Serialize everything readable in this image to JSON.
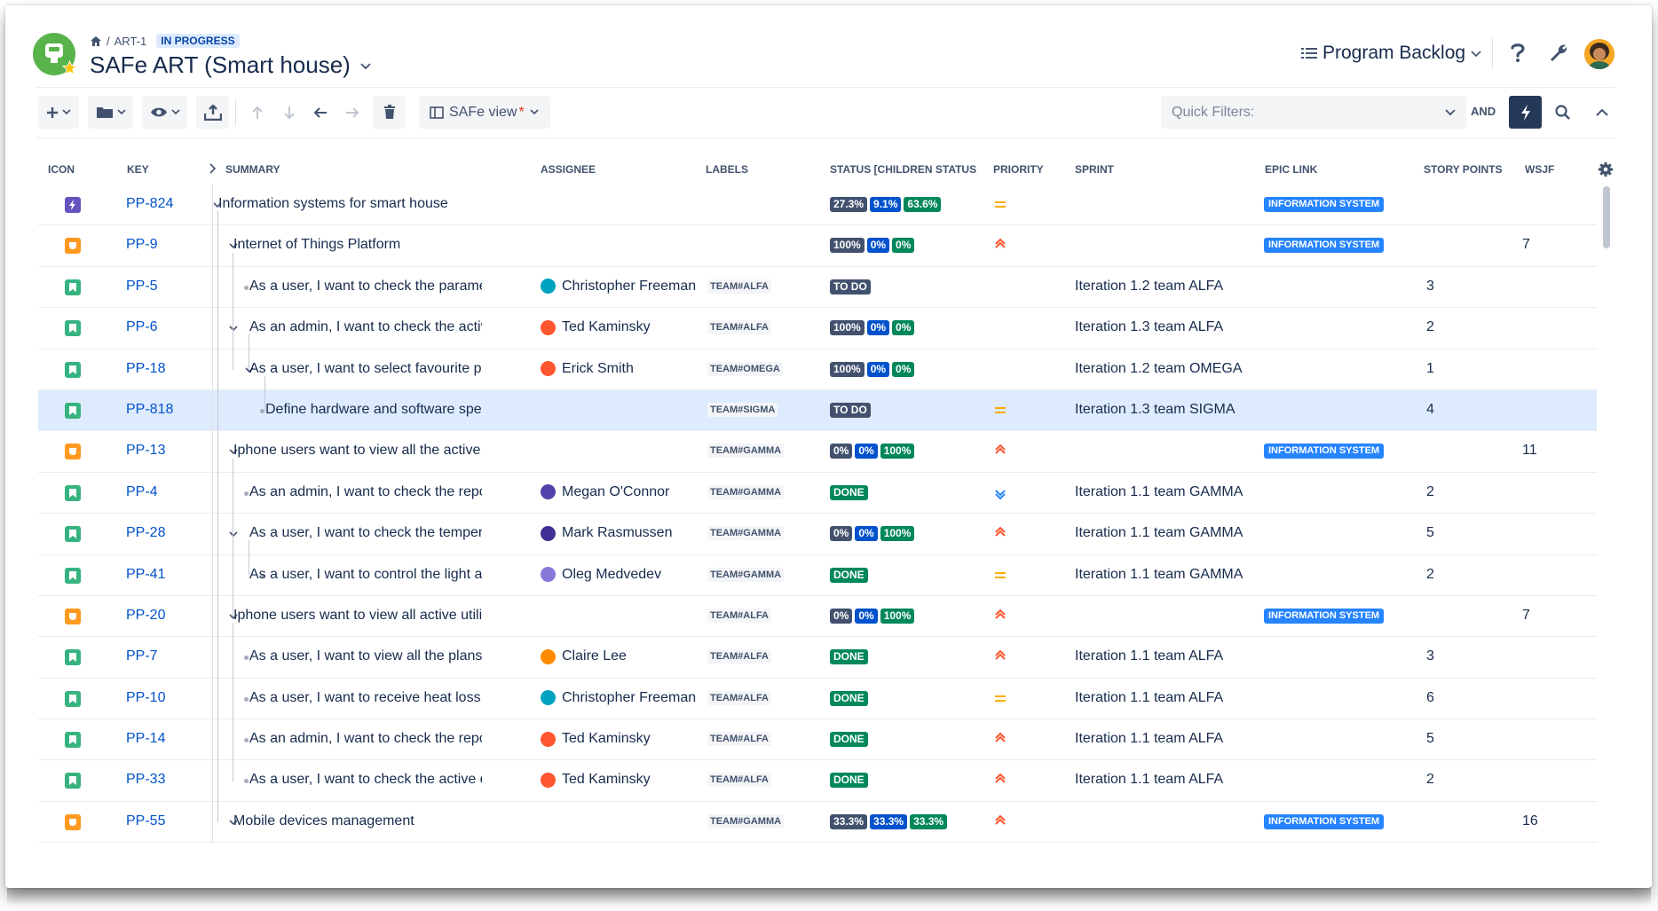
{
  "header": {
    "breadcrumb_key": "ART-1",
    "breadcrumb_status": "IN PROGRESS",
    "title": "SAFe ART (Smart house)",
    "board_switch": "Program Backlog"
  },
  "toolbar": {
    "view_label": "SAFe view",
    "view_required": "*",
    "quick_filters_placeholder": "Quick Filters:",
    "and_label": "AND"
  },
  "columns": {
    "icon": "ICON",
    "key": "KEY",
    "summary": "SUMMARY",
    "assignee": "ASSIGNEE",
    "labels": "LABELS",
    "status": "STATUS [CHILDREN STATUS",
    "priority": "PRIORITY",
    "sprint": "SPRINT",
    "epic_link": "EPIC LINK",
    "story_points": "STORY POINTS",
    "wsjf": "WSJF"
  },
  "colors": {
    "accent": "#0052cc",
    "epic_icon": "#6554c0",
    "feature_icon": "#ff991f",
    "story_icon": "#36b37e",
    "selected_row": "#deebff",
    "priority_high": "#ff5630",
    "priority_medium": "#ffab00",
    "priority_low": "#2684ff"
  },
  "rows": [
    {
      "type": "epic",
      "key": "PP-824",
      "summary": "Information systems for smart house",
      "level": 0,
      "toggle": true,
      "assignee": "",
      "avatar_color": "",
      "label": "",
      "status": [
        {
          "t": "27.3%",
          "c": "gray"
        },
        {
          "t": "9.1%",
          "c": "blue"
        },
        {
          "t": "63.6%",
          "c": "green"
        }
      ],
      "priority": "medium",
      "sprint": "",
      "epic": "INFORMATION SYSTEM",
      "points": "",
      "wsjf": ""
    },
    {
      "type": "feature",
      "key": "PP-9",
      "summary": "Internet of Things Platform",
      "level": 1,
      "toggle": true,
      "assignee": "",
      "avatar_color": "",
      "label": "",
      "status": [
        {
          "t": "100%",
          "c": "gray"
        },
        {
          "t": "0%",
          "c": "blue"
        },
        {
          "t": "0%",
          "c": "green"
        }
      ],
      "priority": "high",
      "sprint": "",
      "epic": "INFORMATION SYSTEM",
      "points": "",
      "wsjf": "7"
    },
    {
      "type": "story",
      "key": "PP-5",
      "summary": "As a user, I want to check the parameters i",
      "level": 2,
      "toggle": false,
      "assignee": "Christopher Freeman",
      "avatar_color": "#00a3bf",
      "label": "TEAM#ALFA",
      "status": [
        {
          "t": "TO DO",
          "c": "gray"
        }
      ],
      "priority": "",
      "sprint": "Iteration 1.2 team ALFA",
      "epic": "",
      "points": "3",
      "wsjf": ""
    },
    {
      "type": "story",
      "key": "PP-6",
      "summary": "As an admin, I want to check the activity of",
      "level": 2,
      "toggle": true,
      "assignee": "Ted Kaminsky",
      "avatar_color": "#ff5630",
      "label": "TEAM#ALFA",
      "status": [
        {
          "t": "100%",
          "c": "gray"
        },
        {
          "t": "0%",
          "c": "blue"
        },
        {
          "t": "0%",
          "c": "green"
        }
      ],
      "priority": "",
      "sprint": "Iteration 1.3 team ALFA",
      "epic": "",
      "points": "2",
      "wsjf": ""
    },
    {
      "type": "story",
      "key": "PP-18",
      "summary": "As a user, I want to select favourite pres",
      "level": 3,
      "toggle": true,
      "assignee": "Erick Smith",
      "avatar_color": "#ff5630",
      "label": "TEAM#OMEGA",
      "status": [
        {
          "t": "100%",
          "c": "gray"
        },
        {
          "t": "0%",
          "c": "blue"
        },
        {
          "t": "0%",
          "c": "green"
        }
      ],
      "priority": "",
      "sprint": "Iteration 1.2 team OMEGA",
      "epic": "",
      "points": "1",
      "wsjf": ""
    },
    {
      "type": "story",
      "key": "PP-818",
      "summary": "Define hardware and software specs",
      "level": 4,
      "toggle": false,
      "selected": true,
      "assignee": "",
      "avatar_color": "",
      "label": "TEAM#SIGMA",
      "status": [
        {
          "t": "TO DO",
          "c": "gray"
        }
      ],
      "priority": "medium",
      "sprint": "Iteration 1.3 team SIGMA",
      "epic": "",
      "points": "4",
      "wsjf": ""
    },
    {
      "type": "feature",
      "key": "PP-13",
      "summary": "Iphone users want to view all the active room",
      "level": 1,
      "toggle": true,
      "assignee": "",
      "avatar_color": "",
      "label": "TEAM#GAMMA",
      "status": [
        {
          "t": "0%",
          "c": "gray"
        },
        {
          "t": "0%",
          "c": "blue"
        },
        {
          "t": "100%",
          "c": "green"
        }
      ],
      "priority": "high",
      "sprint": "",
      "epic": "INFORMATION SYSTEM",
      "points": "",
      "wsjf": "11"
    },
    {
      "type": "story",
      "key": "PP-4",
      "summary": "As an admin, I want to check the report of",
      "level": 2,
      "toggle": false,
      "assignee": "Megan O'Connor",
      "avatar_color": "#5243aa",
      "label": "TEAM#GAMMA",
      "status": [
        {
          "t": "DONE",
          "c": "green"
        }
      ],
      "priority": "low",
      "sprint": "Iteration 1.1 team GAMMA",
      "epic": "",
      "points": "2",
      "wsjf": ""
    },
    {
      "type": "story",
      "key": "PP-28",
      "summary": "As a user, I want to check the temperature",
      "level": 2,
      "toggle": true,
      "assignee": "Mark Rasmussen",
      "avatar_color": "#403294",
      "label": "TEAM#GAMMA",
      "status": [
        {
          "t": "0%",
          "c": "gray"
        },
        {
          "t": "0%",
          "c": "blue"
        },
        {
          "t": "100%",
          "c": "green"
        }
      ],
      "priority": "high",
      "sprint": "Iteration 1.1 team GAMMA",
      "epic": "",
      "points": "5",
      "wsjf": ""
    },
    {
      "type": "story",
      "key": "PP-41",
      "summary": "As a user, I want to control the light auto",
      "level": 3,
      "toggle": false,
      "assignee": "Oleg Medvedev",
      "avatar_color": "#8777d9",
      "label": "TEAM#GAMMA",
      "status": [
        {
          "t": "DONE",
          "c": "green"
        }
      ],
      "priority": "medium",
      "sprint": "Iteration 1.1 team GAMMA",
      "epic": "",
      "points": "2",
      "wsjf": ""
    },
    {
      "type": "feature",
      "key": "PP-20",
      "summary": "Iphone users want to view all active utility roo",
      "level": 1,
      "toggle": true,
      "assignee": "",
      "avatar_color": "",
      "label": "TEAM#ALFA",
      "status": [
        {
          "t": "0%",
          "c": "gray"
        },
        {
          "t": "0%",
          "c": "blue"
        },
        {
          "t": "100%",
          "c": "green"
        }
      ],
      "priority": "high",
      "sprint": "",
      "epic": "INFORMATION SYSTEM",
      "points": "",
      "wsjf": "7"
    },
    {
      "type": "story",
      "key": "PP-7",
      "summary": "As a user, I want to view all the plans",
      "level": 2,
      "toggle": false,
      "assignee": "Claire Lee",
      "avatar_color": "#ff8b00",
      "label": "TEAM#ALFA",
      "status": [
        {
          "t": "DONE",
          "c": "green"
        }
      ],
      "priority": "high",
      "sprint": "Iteration 1.1 team ALFA",
      "epic": "",
      "points": "3",
      "wsjf": ""
    },
    {
      "type": "story",
      "key": "PP-10",
      "summary": "As a user, I want to receive heat loss alarm",
      "level": 2,
      "toggle": false,
      "assignee": "Christopher Freeman",
      "avatar_color": "#00a3bf",
      "label": "TEAM#ALFA",
      "status": [
        {
          "t": "DONE",
          "c": "green"
        }
      ],
      "priority": "medium",
      "sprint": "Iteration 1.1 team ALFA",
      "epic": "",
      "points": "6",
      "wsjf": ""
    },
    {
      "type": "story",
      "key": "PP-14",
      "summary": "As an admin, I want to check the report of",
      "level": 2,
      "toggle": false,
      "assignee": "Ted Kaminsky",
      "avatar_color": "#ff5630",
      "label": "TEAM#ALFA",
      "status": [
        {
          "t": "DONE",
          "c": "green"
        }
      ],
      "priority": "high",
      "sprint": "Iteration 1.1 team ALFA",
      "epic": "",
      "points": "5",
      "wsjf": ""
    },
    {
      "type": "story",
      "key": "PP-33",
      "summary": "As a user, I want to check the active device",
      "level": 2,
      "toggle": false,
      "assignee": "Ted Kaminsky",
      "avatar_color": "#ff5630",
      "label": "TEAM#ALFA",
      "status": [
        {
          "t": "DONE",
          "c": "green"
        }
      ],
      "priority": "high",
      "sprint": "Iteration 1.1 team ALFA",
      "epic": "",
      "points": "2",
      "wsjf": ""
    },
    {
      "type": "feature",
      "key": "PP-55",
      "summary": "Mobile devices management",
      "level": 1,
      "toggle": true,
      "assignee": "",
      "avatar_color": "",
      "label": "TEAM#GAMMA",
      "status": [
        {
          "t": "33.3%",
          "c": "gray"
        },
        {
          "t": "33.3%",
          "c": "blue"
        },
        {
          "t": "33.3%",
          "c": "green"
        }
      ],
      "priority": "high",
      "sprint": "",
      "epic": "INFORMATION SYSTEM",
      "points": "",
      "wsjf": "16"
    }
  ]
}
